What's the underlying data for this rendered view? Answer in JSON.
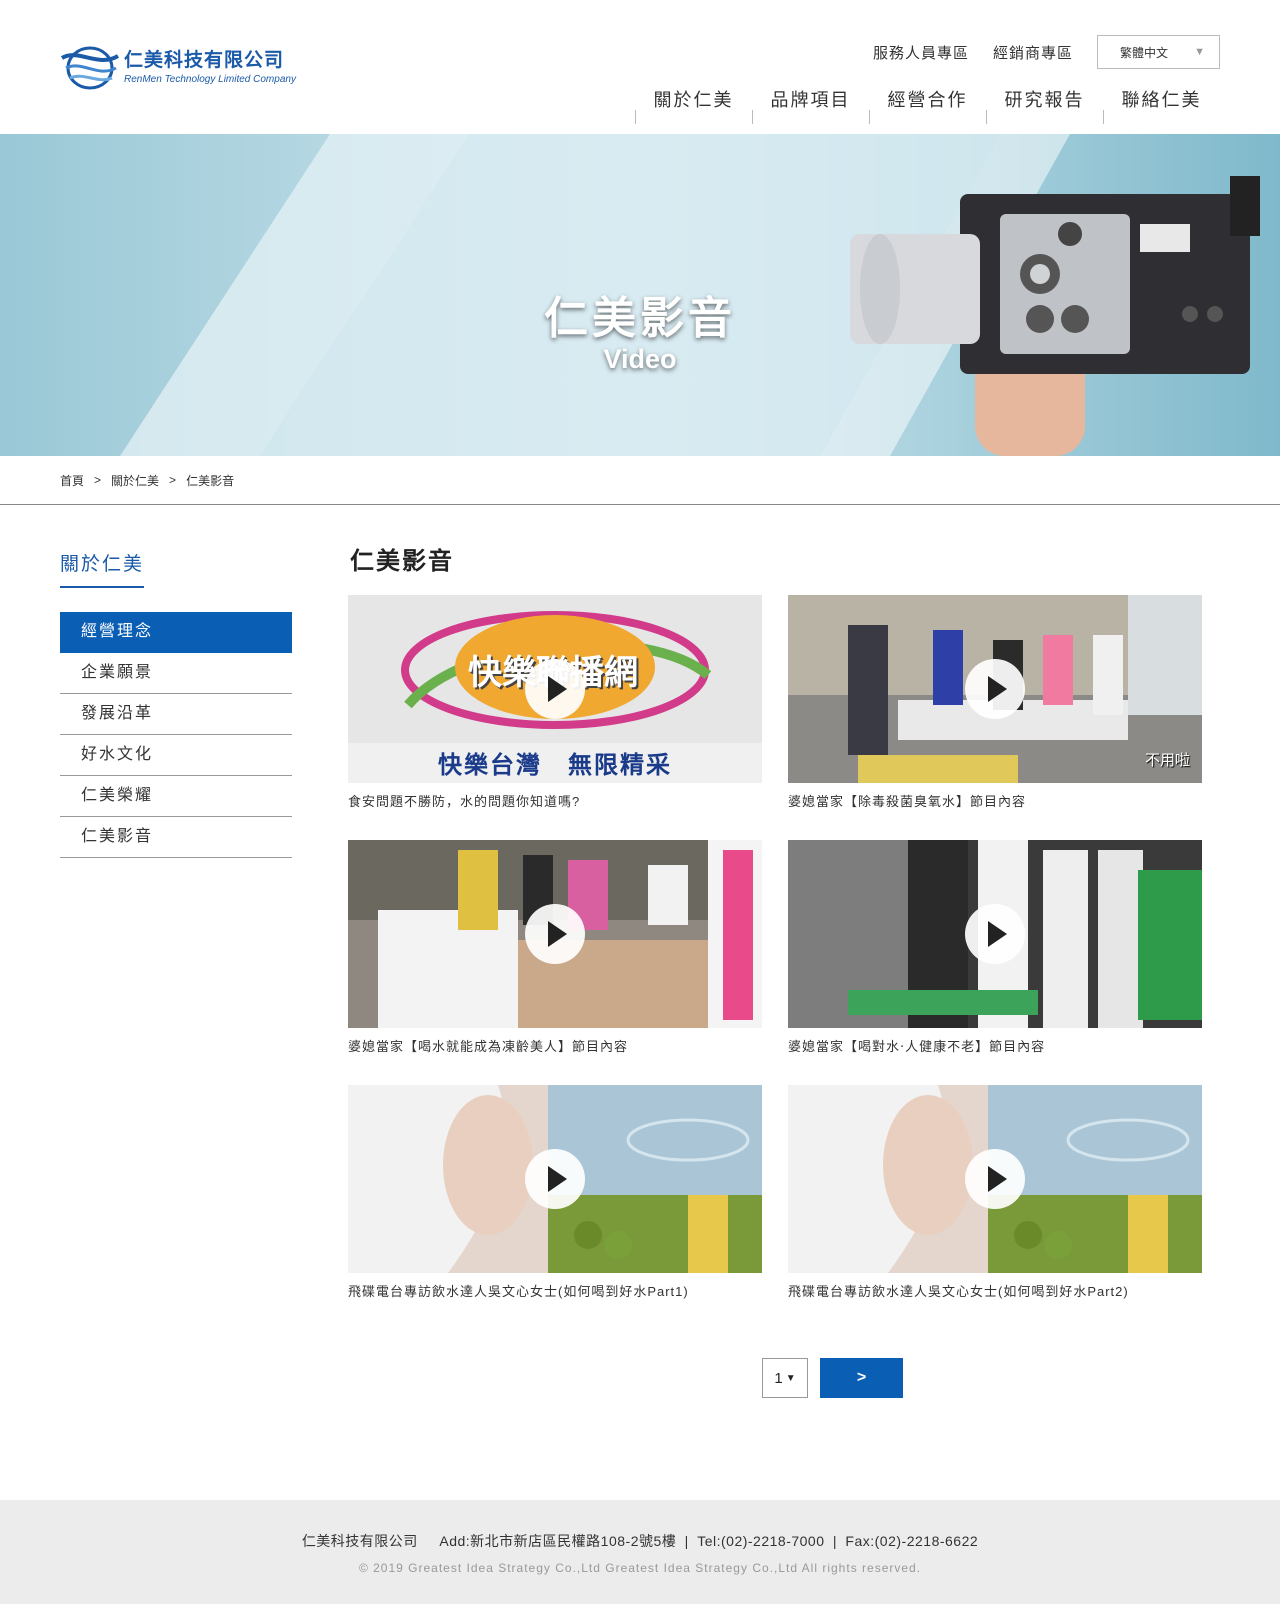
{
  "header": {
    "logo_cn": "仁美科技有限公司",
    "logo_en": "RenMen Technology Limited Company",
    "top_links": [
      "服務人員專區",
      "經銷商專區"
    ],
    "language": "繁體中文",
    "nav": [
      "關於仁美",
      "品牌項目",
      "經營合作",
      "研究報告",
      "聯絡仁美"
    ]
  },
  "banner": {
    "title_cn": "仁美影音",
    "title_en": "Video"
  },
  "breadcrumb": [
    "首頁",
    "關於仁美",
    "仁美影音"
  ],
  "breadcrumb_sep": ">",
  "sidebar": {
    "title": "關於仁美",
    "items": [
      "經營理念",
      "企業願景",
      "發展沿革",
      "好水文化",
      "仁美榮耀",
      "仁美影音"
    ],
    "active_index": 0
  },
  "content": {
    "title": "仁美影音",
    "videos": [
      {
        "caption": "食安問題不勝防，水的問題你知道嗎?",
        "thumb_text_top": "快樂聯播網",
        "thumb_text_bottom": "快樂台灣　無限精采"
      },
      {
        "caption": "婆媳當家【除毒殺菌臭氧水】節目內容",
        "thumb_text": "不用啦"
      },
      {
        "caption": "婆媳當家【喝水就能成為凍齡美人】節目內容"
      },
      {
        "caption": "婆媳當家【喝對水‧人健康不老】節目內容"
      },
      {
        "caption": "飛碟電台專訪飲水達人吳文心女士(如何喝到好水Part1)"
      },
      {
        "caption": "飛碟電台專訪飲水達人吳文心女士(如何喝到好水Part2)"
      }
    ]
  },
  "pager": {
    "current_page": "1",
    "next_label": ">"
  },
  "footer": {
    "company": "仁美科技有限公司",
    "address": "Add:新北市新店區民權路108-2號5樓",
    "tel": "Tel:(02)-2218-7000",
    "fax": "Fax:(02)-2218-6622",
    "separator": "|",
    "copyright": "© 2019 Greatest Idea Strategy Co.,Ltd Greatest Idea Strategy Co.,Ltd All rights reserved."
  },
  "colors": {
    "brand_blue": "#0a5fb5",
    "banner_blue": "#a5d0dc",
    "footer_bg": "#ececec"
  },
  "icons": [
    "logo-wave-icon",
    "chevron-down-icon",
    "play-icon"
  ]
}
